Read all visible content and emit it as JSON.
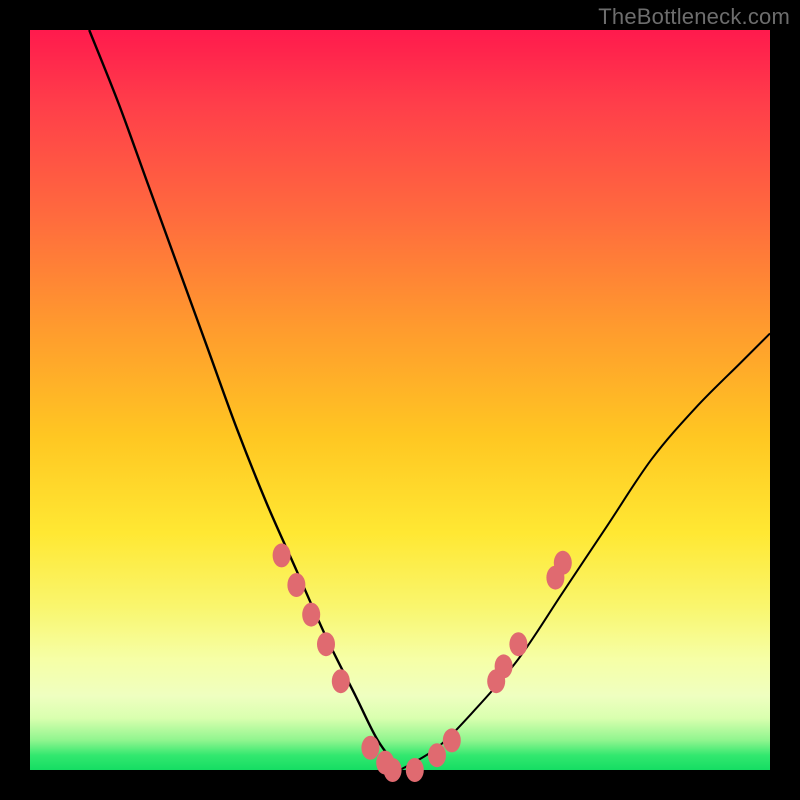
{
  "watermark": "TheBottleneck.com",
  "chart_data": {
    "type": "line",
    "title": "",
    "xlabel": "",
    "ylabel": "",
    "xlim": [
      0,
      100
    ],
    "ylim": [
      0,
      100
    ],
    "background_gradient": {
      "direction": "vertical",
      "stops": [
        {
          "pos": 0,
          "color": "#ff1a4d"
        },
        {
          "pos": 25,
          "color": "#ff6a3e"
        },
        {
          "pos": 55,
          "color": "#ffc722"
        },
        {
          "pos": 78,
          "color": "#f9f66e"
        },
        {
          "pos": 96,
          "color": "#8ff58e"
        },
        {
          "pos": 100,
          "color": "#15dd63"
        }
      ]
    },
    "series": [
      {
        "name": "left-branch",
        "stroke": "#000000",
        "x": [
          8,
          12,
          16,
          20,
          24,
          28,
          32,
          36,
          40,
          44,
          47,
          50
        ],
        "y": [
          100,
          90,
          79,
          68,
          57,
          46,
          36,
          27,
          18,
          10,
          4,
          0
        ]
      },
      {
        "name": "right-branch",
        "stroke": "#000000",
        "x": [
          50,
          55,
          60,
          66,
          72,
          78,
          84,
          90,
          96,
          100
        ],
        "y": [
          0,
          3,
          8,
          15,
          24,
          33,
          42,
          49,
          55,
          59
        ]
      }
    ],
    "markers": [
      {
        "series": "left-branch",
        "x": 34,
        "y": 29,
        "color": "#e06a70"
      },
      {
        "series": "left-branch",
        "x": 36,
        "y": 25,
        "color": "#e06a70"
      },
      {
        "series": "left-branch",
        "x": 38,
        "y": 21,
        "color": "#e06a70"
      },
      {
        "series": "left-branch",
        "x": 40,
        "y": 17,
        "color": "#e06a70"
      },
      {
        "series": "left-branch",
        "x": 42,
        "y": 12,
        "color": "#e06a70"
      },
      {
        "series": "left-branch",
        "x": 46,
        "y": 3,
        "color": "#e06a70"
      },
      {
        "series": "left-branch",
        "x": 48,
        "y": 1,
        "color": "#e06a70"
      },
      {
        "series": "left-branch",
        "x": 49,
        "y": 0,
        "color": "#e06a70"
      },
      {
        "series": "left-branch",
        "x": 52,
        "y": 0,
        "color": "#e06a70"
      },
      {
        "series": "right-branch",
        "x": 55,
        "y": 2,
        "color": "#e06a70"
      },
      {
        "series": "right-branch",
        "x": 57,
        "y": 4,
        "color": "#e06a70"
      },
      {
        "series": "right-branch",
        "x": 63,
        "y": 12,
        "color": "#e06a70"
      },
      {
        "series": "right-branch",
        "x": 64,
        "y": 14,
        "color": "#e06a70"
      },
      {
        "series": "right-branch",
        "x": 66,
        "y": 17,
        "color": "#e06a70"
      },
      {
        "series": "right-branch",
        "x": 71,
        "y": 26,
        "color": "#e06a70"
      },
      {
        "series": "right-branch",
        "x": 72,
        "y": 28,
        "color": "#e06a70"
      }
    ]
  }
}
